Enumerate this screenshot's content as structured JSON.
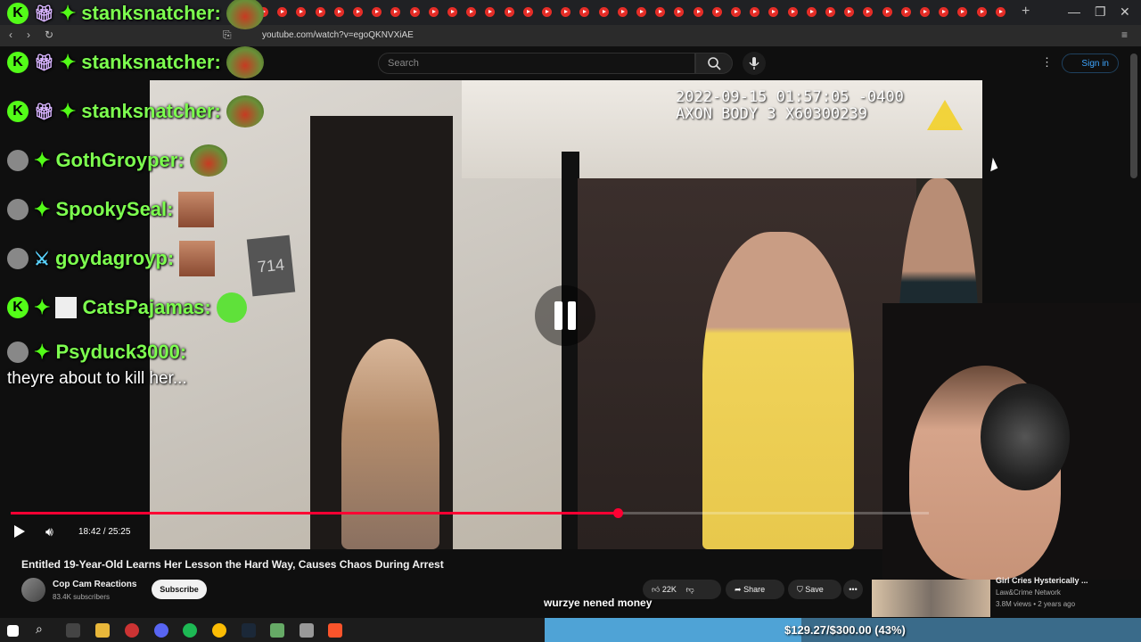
{
  "browser": {
    "url": "youtube.com/watch?v=egoQKNVXiAE",
    "new_tab": "+",
    "window_controls": [
      "—",
      "❐",
      "✕"
    ]
  },
  "youtube": {
    "search_placeholder": "Search",
    "sign_in": "Sign in",
    "player": {
      "time": "18:42 / 25:25",
      "progress": 0.7351
    },
    "video": {
      "title": "Entitled 19-Year-Old Learns Her Lesson the Hard Way, Causes Chaos During Arrest",
      "channel": "Cop Cam Reactions",
      "subscribers": "83.4K subscribers",
      "subscribe_label": "Subscribe",
      "likes": "22K",
      "share_label": "Share",
      "save_label": "Save",
      "more_label": "•••"
    },
    "recommendation": {
      "title": "Girl Cries Hysterically ...",
      "channel": "Law&Crime Network",
      "meta": "3.8M views • 2 years ago"
    }
  },
  "bodycam": {
    "timestamp": "2022-09-15 01:57:05 -0400",
    "device": "AXON BODY 3 X60300239",
    "door_number": "714"
  },
  "chat": {
    "lines": [
      {
        "user": "stanksnatcher:"
      },
      {
        "user": "stanksnatcher:"
      },
      {
        "user": "stanksnatcher:"
      },
      {
        "user": "GothGroyper:"
      },
      {
        "user": "SpookySeal:"
      },
      {
        "user": "goydagroyp:"
      },
      {
        "user": "CatsPajamas:"
      },
      {
        "user": "Psyduck3000:"
      }
    ],
    "message": "theyre about to kill her..."
  },
  "stream": {
    "caption": "wurzye nened money",
    "goal_text": "$129.27/$300.00 (43%)",
    "goal_fraction": 0.43
  },
  "colors": {
    "youtube_red": "#ff0033",
    "kick_green": "#53fc18",
    "link_blue": "#3ea6ff"
  }
}
